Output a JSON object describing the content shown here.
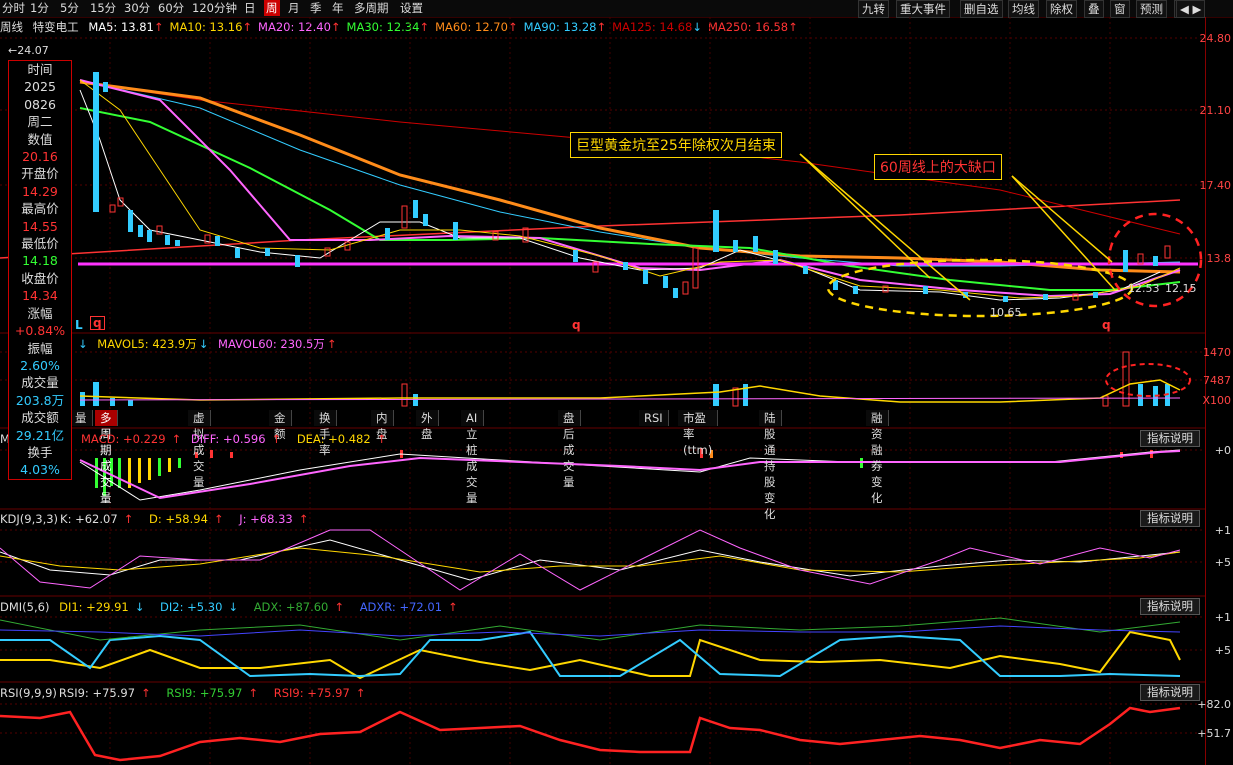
{
  "toolbar": {
    "left": [
      "分时",
      "1分",
      "5分",
      "15分",
      "30分",
      "60分",
      "120分钟",
      "日",
      "周",
      "月",
      "季",
      "年",
      "多周期",
      "设置"
    ],
    "active_index": 8,
    "right": [
      "九转",
      "重大事件",
      "删自选",
      "均线",
      "除权",
      "叠",
      "窗",
      "预测",
      "更多"
    ]
  },
  "header": {
    "period": "周线",
    "stock": "特变电工",
    "ma": [
      {
        "label": "MA5: 13.81",
        "arrow": "↑",
        "color": "#ffffff"
      },
      {
        "label": "MA10: 13.16",
        "arrow": "↑",
        "color": "#ffd700"
      },
      {
        "label": "MA20: 12.40",
        "arrow": "↑",
        "color": "#ff66ff"
      },
      {
        "label": "MA30: 12.34",
        "arrow": "↑",
        "color": "#33ff33"
      },
      {
        "label": "MA60: 12.70",
        "arrow": "↑",
        "color": "#ff8c1a"
      },
      {
        "label": "MA90: 13.28",
        "arrow": "↑",
        "color": "#33ccff"
      },
      {
        "label": "MA125: 14.68",
        "arrow": "↓",
        "color": "#cc0000"
      },
      {
        "label": "MA250: 16.58",
        "arrow": "↑",
        "color": "#ff3333"
      }
    ]
  },
  "price_axis": [
    "24.80",
    "21.10",
    "17.40",
    "13.8"
  ],
  "price_marks": {
    "high": "24.07",
    "low": "10.65",
    "mid": "12.53",
    "mid2": "12.15"
  },
  "volume_axis": [
    "1470",
    "7487",
    "X100"
  ],
  "info_panel": [
    {
      "label": "时间",
      "value": "2025",
      "cls": "valw"
    },
    {
      "label": "",
      "value": "0826",
      "cls": "valw"
    },
    {
      "label": "",
      "value": "周二",
      "cls": "valw"
    },
    {
      "label": "数值",
      "value": "20.16",
      "cls": "valr"
    },
    {
      "label": "开盘价",
      "value": "14.29",
      "cls": "valr"
    },
    {
      "label": "最高价",
      "value": "14.55",
      "cls": "valr"
    },
    {
      "label": "最低价",
      "value": "14.18",
      "cls": "valg"
    },
    {
      "label": "收盘价",
      "value": "14.34",
      "cls": "valr"
    },
    {
      "label": "涨幅",
      "value": "+0.84%",
      "cls": "valr"
    },
    {
      "label": "振幅",
      "value": "2.60%",
      "cls": "valc"
    },
    {
      "label": "成交量",
      "value": "203.8万",
      "cls": "valc"
    },
    {
      "label": "成交额",
      "value": "29.21亿",
      "cls": "valc"
    },
    {
      "label": "换手",
      "value": "4.03%",
      "cls": "valc"
    }
  ],
  "annotations": {
    "a1": "巨型黄金坑至25年除权次月结束",
    "a2": "60周线上的大缺口"
  },
  "markers": {
    "L": "L",
    "q": "q"
  },
  "volume": {
    "mavol5": "MAVOL5: 423.9万",
    "mavol5_arrow": "↓",
    "mavol60": "MAVOL60: 230.5万",
    "mavol60_arrow": "↑"
  },
  "indicator_tabs": [
    "量",
    "多周期成交量",
    "虚拟成交量",
    "金额",
    "换手率",
    "内盘",
    "外盘",
    "AI立桩成交量",
    "盘后成交量",
    "RSI",
    "市盈率(ttm)",
    "陆股通持股变化",
    "融资融券变化"
  ],
  "indicator_tabs_active": 1,
  "macd": {
    "name": "MACD(12,26,9)",
    "visible_name": "MI",
    "macd": "MACD: +0.229",
    "diff": "DIFF: +0.596",
    "dea": "DEA: +0.482",
    "axis": "+0"
  },
  "kdj": {
    "name": "KDJ(9,3,3)",
    "k": "K: +62.07",
    "d": "D: +58.94",
    "j": "J: +68.33",
    "axis1": "+1",
    "axis2": "+5"
  },
  "dmi": {
    "name": "DMI(5,6)",
    "di1": "DI1: +29.91",
    "di2": "DI2: +5.30",
    "adx": "ADX: +87.60",
    "adxr": "ADXR: +72.01",
    "axis1": "+1",
    "axis2": "+5"
  },
  "rsi": {
    "name": "RSI(9,9,9)",
    "r1": "RSI9: +75.97",
    "r2": "RSI9: +75.97",
    "r3": "RSI9: +75.97",
    "axis1": "+82.0",
    "axis2": "+51.7"
  },
  "indicator_button": "指标说明"
}
